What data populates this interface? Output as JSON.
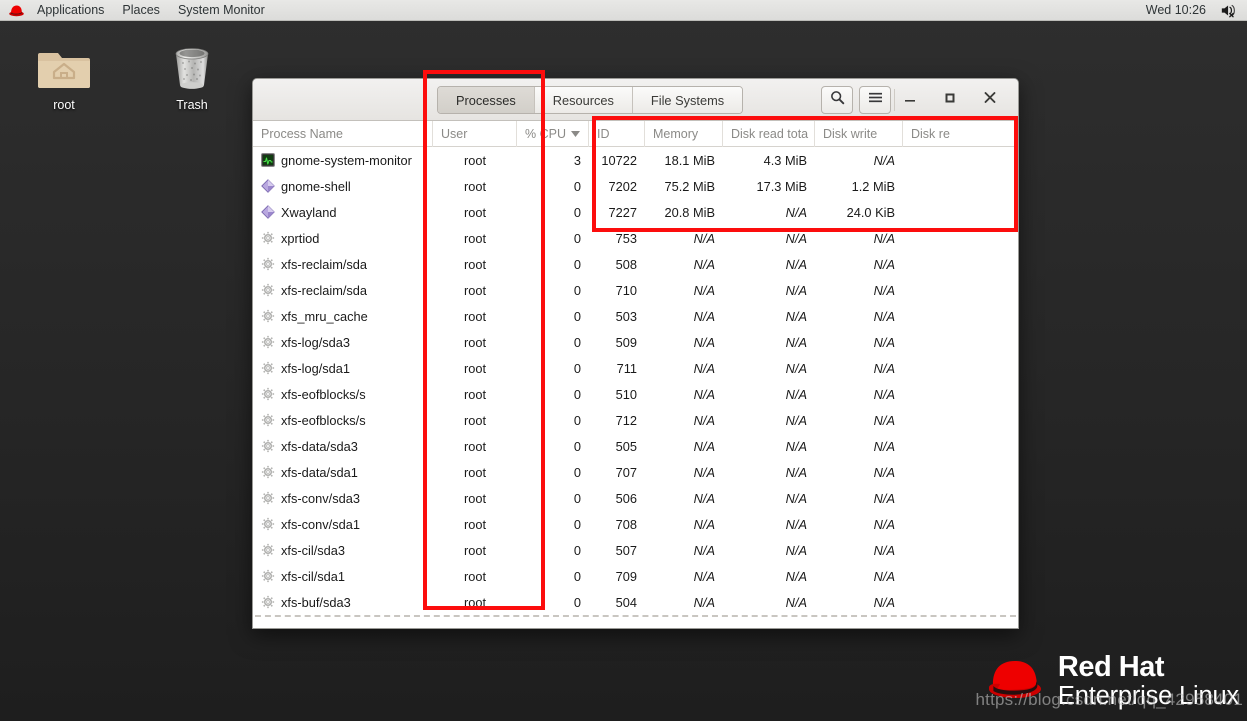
{
  "top_panel": {
    "logo_icon": "redhat-logo-icon",
    "items": [
      {
        "label": "Applications",
        "name": "applications-menu"
      },
      {
        "label": "Places",
        "name": "places-menu"
      },
      {
        "label": "System Monitor",
        "name": "system-monitor-menu"
      }
    ],
    "clock": "Wed 10:26",
    "volume_icon": "volume-muted-icon"
  },
  "desktop": {
    "icons": [
      {
        "label": "root",
        "icon": "home-folder-icon"
      },
      {
        "label": "Trash",
        "icon": "trash-icon"
      }
    ]
  },
  "window": {
    "tabs": [
      {
        "label": "Processes",
        "active": true
      },
      {
        "label": "Resources",
        "active": false
      },
      {
        "label": "File Systems",
        "active": false
      }
    ],
    "search_icon": "search-icon",
    "menu_icon": "hamburger-menu-icon",
    "minimize_icon": "minimize-icon",
    "maximize_icon": "maximize-icon",
    "close_icon": "close-icon"
  },
  "table": {
    "columns": [
      {
        "key": "name",
        "label": "Process Name"
      },
      {
        "key": "user",
        "label": "User"
      },
      {
        "key": "cpu",
        "label": "% CPU",
        "sort": "descending"
      },
      {
        "key": "id",
        "label": "ID"
      },
      {
        "key": "memory",
        "label": "Memory"
      },
      {
        "key": "dread",
        "label": "Disk read tota"
      },
      {
        "key": "dwrite",
        "label": "Disk write "
      },
      {
        "key": "dreadc",
        "label": "Disk re"
      }
    ],
    "rows": [
      {
        "icon": "app-monitor-icon",
        "name": "gnome-system-monitor",
        "user": "root",
        "cpu": "3",
        "id": "10722",
        "memory": "18.1 MiB",
        "dread": "4.3 MiB",
        "dwrite": "N/A",
        "dreadc": ""
      },
      {
        "icon": "app-diamond-icon",
        "name": "gnome-shell",
        "user": "root",
        "cpu": "0",
        "id": "7202",
        "memory": "75.2 MiB",
        "dread": "17.3 MiB",
        "dwrite": "1.2 MiB",
        "dreadc": ""
      },
      {
        "icon": "app-diamond-icon",
        "name": "Xwayland",
        "user": "root",
        "cpu": "0",
        "id": "7227",
        "memory": "20.8 MiB",
        "dread": "N/A",
        "dwrite": "24.0 KiB",
        "dreadc": ""
      },
      {
        "icon": "gear-icon",
        "name": "xprtiod",
        "user": "root",
        "cpu": "0",
        "id": "753",
        "memory": "N/A",
        "dread": "N/A",
        "dwrite": "N/A",
        "dreadc": ""
      },
      {
        "icon": "gear-icon",
        "name": "xfs-reclaim/sda",
        "user": "root",
        "cpu": "0",
        "id": "508",
        "memory": "N/A",
        "dread": "N/A",
        "dwrite": "N/A",
        "dreadc": ""
      },
      {
        "icon": "gear-icon",
        "name": "xfs-reclaim/sda",
        "user": "root",
        "cpu": "0",
        "id": "710",
        "memory": "N/A",
        "dread": "N/A",
        "dwrite": "N/A",
        "dreadc": ""
      },
      {
        "icon": "gear-icon",
        "name": "xfs_mru_cache",
        "user": "root",
        "cpu": "0",
        "id": "503",
        "memory": "N/A",
        "dread": "N/A",
        "dwrite": "N/A",
        "dreadc": ""
      },
      {
        "icon": "gear-icon",
        "name": "xfs-log/sda3",
        "user": "root",
        "cpu": "0",
        "id": "509",
        "memory": "N/A",
        "dread": "N/A",
        "dwrite": "N/A",
        "dreadc": ""
      },
      {
        "icon": "gear-icon",
        "name": "xfs-log/sda1",
        "user": "root",
        "cpu": "0",
        "id": "711",
        "memory": "N/A",
        "dread": "N/A",
        "dwrite": "N/A",
        "dreadc": ""
      },
      {
        "icon": "gear-icon",
        "name": "xfs-eofblocks/s",
        "user": "root",
        "cpu": "0",
        "id": "510",
        "memory": "N/A",
        "dread": "N/A",
        "dwrite": "N/A",
        "dreadc": ""
      },
      {
        "icon": "gear-icon",
        "name": "xfs-eofblocks/s",
        "user": "root",
        "cpu": "0",
        "id": "712",
        "memory": "N/A",
        "dread": "N/A",
        "dwrite": "N/A",
        "dreadc": ""
      },
      {
        "icon": "gear-icon",
        "name": "xfs-data/sda3",
        "user": "root",
        "cpu": "0",
        "id": "505",
        "memory": "N/A",
        "dread": "N/A",
        "dwrite": "N/A",
        "dreadc": ""
      },
      {
        "icon": "gear-icon",
        "name": "xfs-data/sda1",
        "user": "root",
        "cpu": "0",
        "id": "707",
        "memory": "N/A",
        "dread": "N/A",
        "dwrite": "N/A",
        "dreadc": ""
      },
      {
        "icon": "gear-icon",
        "name": "xfs-conv/sda3",
        "user": "root",
        "cpu": "0",
        "id": "506",
        "memory": "N/A",
        "dread": "N/A",
        "dwrite": "N/A",
        "dreadc": ""
      },
      {
        "icon": "gear-icon",
        "name": "xfs-conv/sda1",
        "user": "root",
        "cpu": "0",
        "id": "708",
        "memory": "N/A",
        "dread": "N/A",
        "dwrite": "N/A",
        "dreadc": ""
      },
      {
        "icon": "gear-icon",
        "name": "xfs-cil/sda3",
        "user": "root",
        "cpu": "0",
        "id": "507",
        "memory": "N/A",
        "dread": "N/A",
        "dwrite": "N/A",
        "dreadc": ""
      },
      {
        "icon": "gear-icon",
        "name": "xfs-cil/sda1",
        "user": "root",
        "cpu": "0",
        "id": "709",
        "memory": "N/A",
        "dread": "N/A",
        "dwrite": "N/A",
        "dreadc": ""
      },
      {
        "icon": "gear-icon",
        "name": "xfs-buf/sda3",
        "user": "root",
        "cpu": "0",
        "id": "504",
        "memory": "N/A",
        "dread": "N/A",
        "dwrite": "N/A",
        "dreadc": ""
      }
    ]
  },
  "annotations": {
    "box_color": "#fc0d0d",
    "boxes": [
      {
        "name": "user-column-highlight"
      },
      {
        "name": "top-rows-data-highlight"
      }
    ]
  },
  "branding": {
    "line1": "Red Hat",
    "line2": "Enterprise Linux",
    "logo_icon": "redhat-hat-logo-icon",
    "watermark": "https://blog.csdn.net/qq_42958401"
  }
}
